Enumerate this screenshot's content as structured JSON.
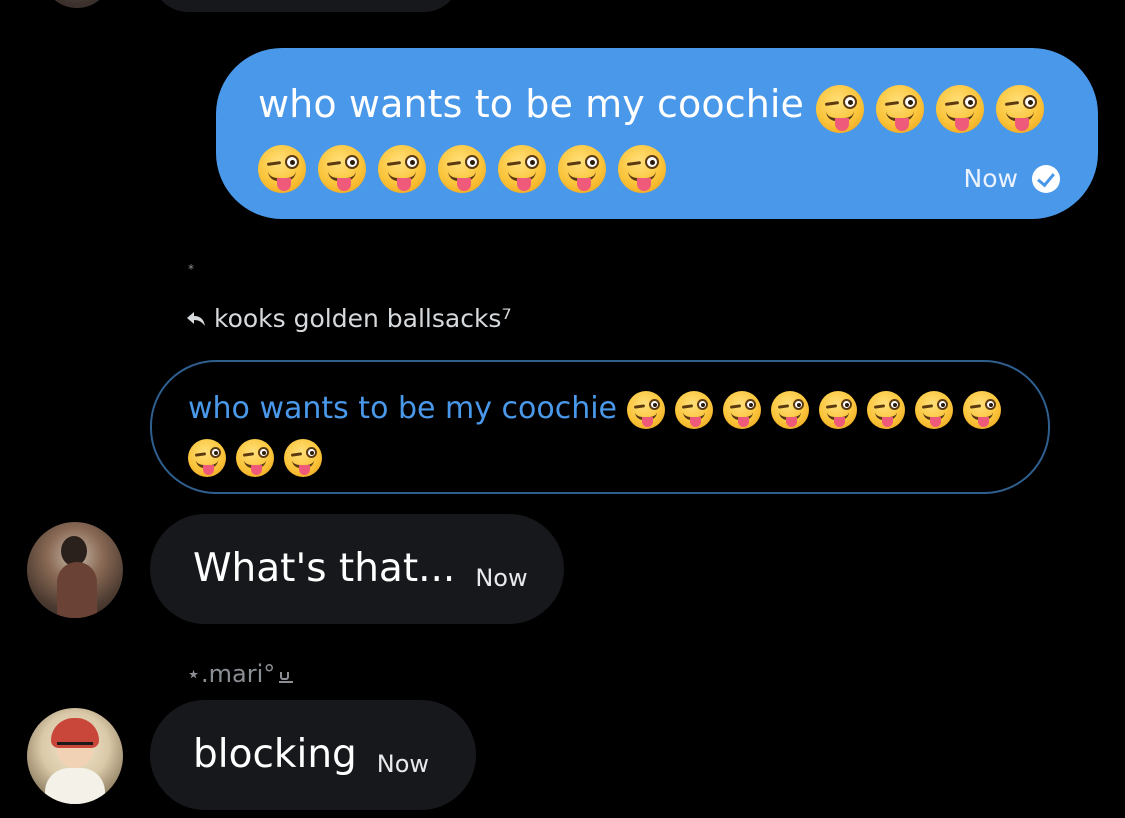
{
  "colors": {
    "background": "#000000",
    "sent_bubble": "#4a98e9",
    "received_bubble": "#16181c",
    "quote_border": "#2f5f8f",
    "quote_text": "#4a98e9",
    "muted_text": "#8b8f94"
  },
  "sent_message": {
    "text": "who wants to be my coochie",
    "emoji": "winking-face-with-tongue",
    "emoji_count": 11,
    "time": "Now",
    "status_icon": "check-circle-icon"
  },
  "tiny_marker": "*",
  "reply": {
    "icon": "reply-arrow-icon",
    "to_name": "kooks golden ballsacks⁷"
  },
  "quoted_message": {
    "text": "who wants to be my coochie",
    "emoji": "winking-face-with-tongue",
    "emoji_count": 11
  },
  "received_messages": [
    {
      "avatar": "user-avatar",
      "text": "What's that...",
      "time": "Now"
    },
    {
      "sender_name": "⋆.mari°",
      "sender_icon": "coffee-cup-icon",
      "avatar": "user-avatar",
      "text": "blocking",
      "time": "Now"
    }
  ]
}
